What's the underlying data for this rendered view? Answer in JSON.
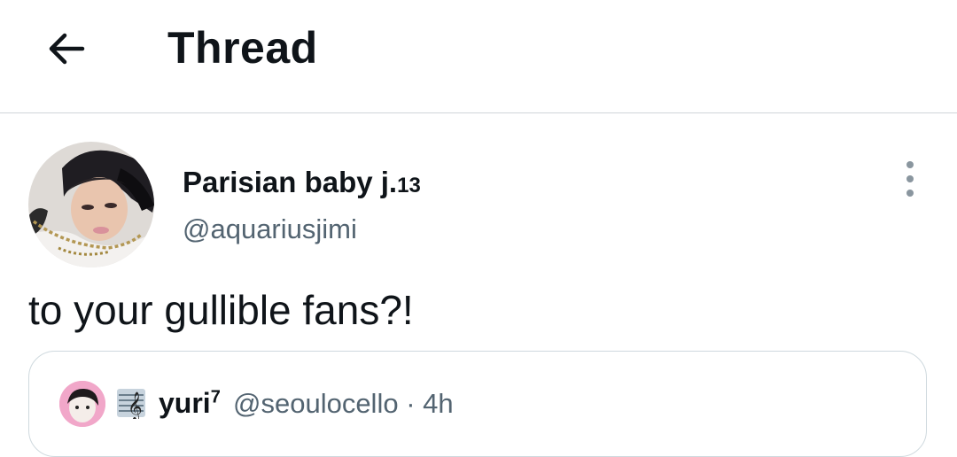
{
  "header": {
    "title": "Thread",
    "back_icon": "arrow-left-icon"
  },
  "tweet": {
    "author": {
      "display_name": "Parisian baby j.",
      "name_suffix": "13",
      "handle": "@aquariusjimi"
    },
    "more_icon": "more-vertical-icon",
    "text": "to your gullible fans?!"
  },
  "quoted_tweet": {
    "emoji_icon": "musical-score-icon",
    "author": {
      "display_name": "yuri",
      "name_sup": "7",
      "handle": "@seoulocello"
    },
    "separator": "·",
    "time": "4h"
  },
  "colors": {
    "text": "#0f1419",
    "secondary": "#536471",
    "border": "#cfd9de",
    "divider": "#d0d5d9"
  }
}
